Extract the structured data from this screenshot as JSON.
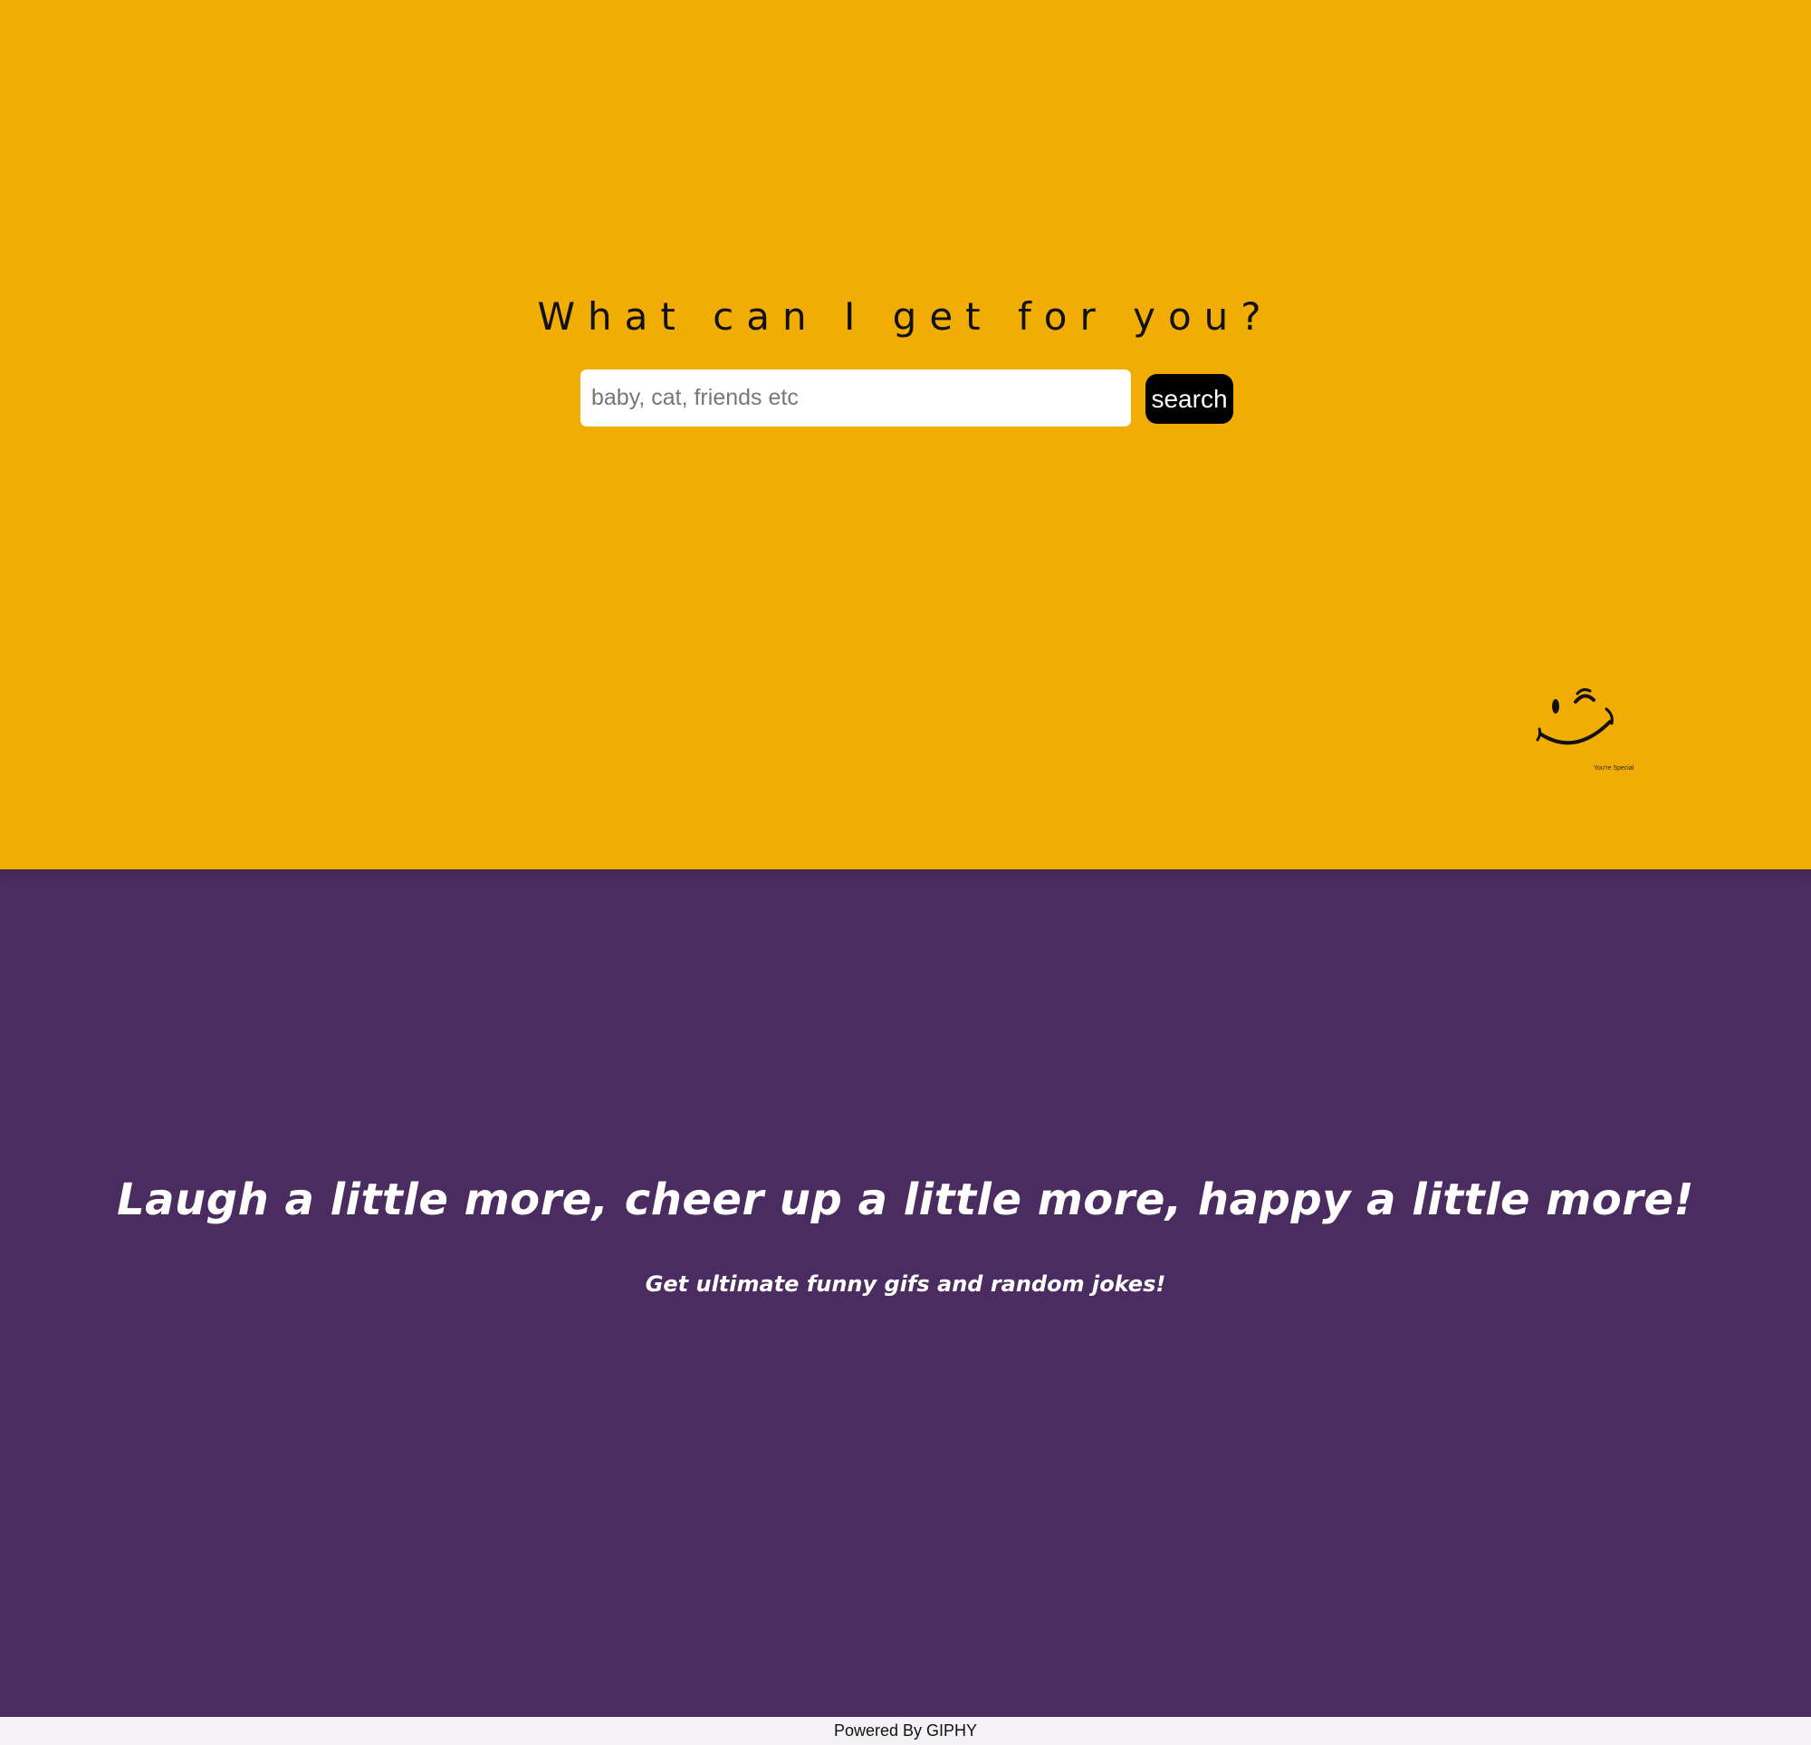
{
  "hero": {
    "heading": "What can I get for you?",
    "search": {
      "placeholder": "baby, cat, friends etc",
      "value": "",
      "button_label": "search"
    },
    "decoration": {
      "icon": "winking-smiley-icon",
      "caption": "You're Special"
    }
  },
  "band": {
    "tagline": "Laugh a little more, cheer up a little more, happy a little more!",
    "subtagline": "Get ultimate funny gifs and random jokes!"
  },
  "footer": {
    "text": "Powered By GIPHY"
  },
  "colors": {
    "hero_background": "#f2ad05",
    "band_background": "#4a2c60",
    "button_background": "#000000",
    "footer_background": "#f4f2f5"
  }
}
